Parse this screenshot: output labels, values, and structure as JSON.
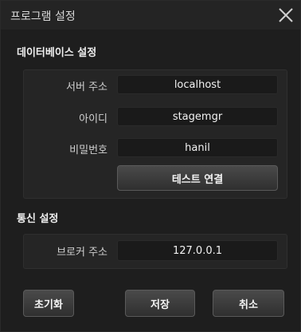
{
  "window": {
    "title": "프로그램 설정",
    "close_icon": "close-icon"
  },
  "database": {
    "heading": "데이터베이스 설정",
    "server_label": "서버 주소",
    "server_value": "localhost",
    "id_label": "아이디",
    "id_value": "stagemgr",
    "password_label": "비밀번호",
    "password_value": "hanil",
    "test_button": "테스트 연결"
  },
  "communication": {
    "heading": "통신 설정",
    "broker_label": "브로커 주소",
    "broker_value": "127.0.0.1"
  },
  "footer": {
    "reset_button": "초기화",
    "save_button": "저장",
    "cancel_button": "취소"
  }
}
